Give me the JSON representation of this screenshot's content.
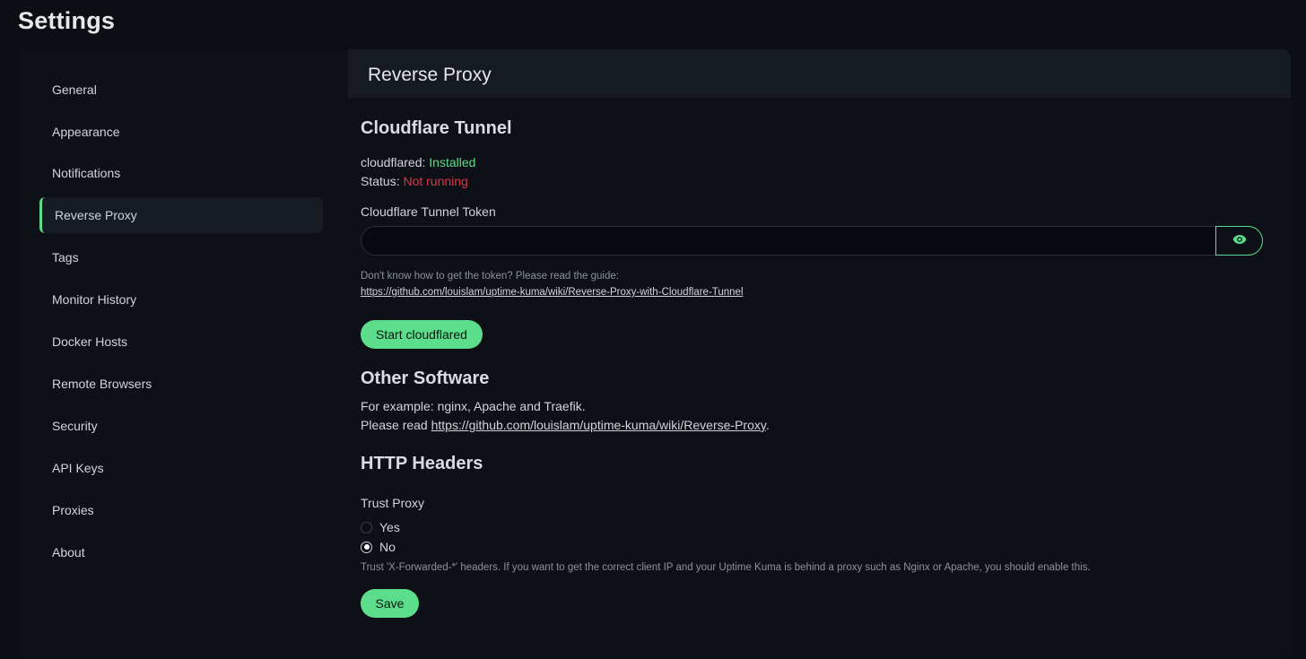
{
  "page": {
    "title": "Settings"
  },
  "sidebar": {
    "items": [
      {
        "label": "General"
      },
      {
        "label": "Appearance"
      },
      {
        "label": "Notifications"
      },
      {
        "label": "Reverse Proxy",
        "active": true
      },
      {
        "label": "Tags"
      },
      {
        "label": "Monitor History"
      },
      {
        "label": "Docker Hosts"
      },
      {
        "label": "Remote Browsers"
      },
      {
        "label": "Security"
      },
      {
        "label": "API Keys"
      },
      {
        "label": "Proxies"
      },
      {
        "label": "About"
      }
    ]
  },
  "main": {
    "header": "Reverse Proxy",
    "cloudflare": {
      "title": "Cloudflare Tunnel",
      "installed_label": "cloudflared: ",
      "installed_value": "Installed",
      "status_label": "Status: ",
      "status_value": "Not running",
      "token_label": "Cloudflare Tunnel Token",
      "token_value": "",
      "token_toggle_icon": "eye-icon",
      "help_text": "Don't know how to get the token? Please read the guide:",
      "guide_link": "https://github.com/louislam/uptime-kuma/wiki/Reverse-Proxy-with-Cloudflare-Tunnel",
      "start_button": "Start cloudflared"
    },
    "other": {
      "title": "Other Software",
      "example_text": "For example: nginx, Apache and Traefik.",
      "read_prefix": "Please read ",
      "read_link": "https://github.com/louislam/uptime-kuma/wiki/Reverse-Proxy",
      "read_suffix": "."
    },
    "http_headers": {
      "title": "HTTP Headers",
      "trust_proxy_label": "Trust Proxy",
      "option_yes": "Yes",
      "option_no": "No",
      "selected": "No",
      "help_text": "Trust 'X-Forwarded-*' headers. If you want to get the correct client IP and your Uptime Kuma is behind a proxy such as Nginx or Apache, you should enable this.",
      "save_button": "Save"
    }
  },
  "colors": {
    "accent": "#5cdd8b",
    "danger": "#dc3545",
    "background": "#0b0e13",
    "panel": "#0d1117",
    "header": "#161b22"
  }
}
